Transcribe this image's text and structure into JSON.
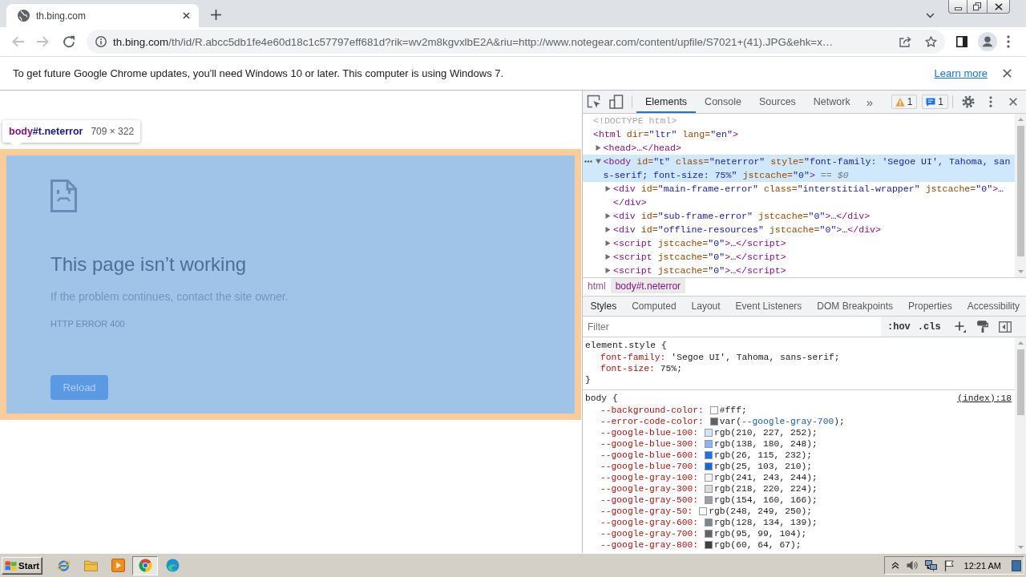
{
  "browser": {
    "tabs": [
      {
        "title": "th.bing.com",
        "selected": true
      }
    ],
    "navigation": [
      {
        "kind": "back",
        "disabled": true
      },
      {
        "kind": "forward",
        "disabled": true
      },
      {
        "kind": "reload",
        "disabled": false
      }
    ],
    "address": {
      "host": "th.bing.com",
      "path": "/th/id/R.abcc5db1fe4e60d18c1c57797eff681d?rik=wv2m8kgvxlbE2A&riu=http://www.notegear.com/content/upfile/S7021+(41).JPG&ehk=x…"
    }
  },
  "infobar": {
    "message": "To get future Google Chrome updates, you'll need Windows 10 or later. This computer is using Windows 7.",
    "link": "Learn more"
  },
  "page": {
    "inspect_tooltip": {
      "tag": "body",
      "selector": "#t.neterror",
      "size": "709 × 322"
    },
    "error": {
      "title": "This page isn’t working",
      "message": "If the problem continues, contact the site owner.",
      "code": "HTTP ERROR 400",
      "button": "Reload"
    }
  },
  "devtools": {
    "tabs": [
      {
        "label": "Elements",
        "selected": true
      },
      {
        "label": "Console",
        "selected": false
      },
      {
        "label": "Sources",
        "selected": false
      },
      {
        "label": "Network",
        "selected": false
      }
    ],
    "more_tabs": "»",
    "counters": [
      {
        "kind": "warning",
        "count": "1"
      },
      {
        "kind": "message",
        "count": "1"
      }
    ],
    "dom": [
      {
        "tokens": [
          {
            "kind": "doctype",
            "text": "<!DOCTYPE html>"
          }
        ],
        "selected": false
      },
      {
        "tokens": [
          {
            "kind": "tag",
            "text": "<html"
          },
          {
            "kind": "attr",
            "text": " dir="
          },
          {
            "kind": "value",
            "text": "\"ltr\""
          },
          {
            "kind": "attr",
            "text": " lang="
          },
          {
            "kind": "value",
            "text": "\"en\""
          },
          {
            "kind": "tag",
            "text": ">"
          }
        ],
        "selected": false,
        "children": [
          {
            "tokens": [
              {
                "kind": "tag",
                "text": "<head>"
              },
              {
                "kind": "plain",
                "text": "…"
              },
              {
                "kind": "tag",
                "text": "</head>"
              }
            ],
            "expanded": false,
            "selected": false
          },
          {
            "tokens": [
              {
                "kind": "tag",
                "text": "<body"
              },
              {
                "kind": "attr",
                "text": " id="
              },
              {
                "kind": "value",
                "text": "\"t\""
              },
              {
                "kind": "attr",
                "text": " class="
              },
              {
                "kind": "value",
                "text": "\"neterror\""
              },
              {
                "kind": "attr",
                "text": " style="
              },
              {
                "kind": "value",
                "text": "\"font-family: 'Segoe UI', Tahoma, sans-serif; font-size: 75%\""
              },
              {
                "kind": "attr",
                "text": " jstcache="
              },
              {
                "kind": "value",
                "text": "\"0\""
              },
              {
                "kind": "tag",
                "text": ">"
              },
              {
                "kind": "hint",
                "text": " == $0"
              }
            ],
            "expanded": true,
            "selected": true,
            "children": [
              {
                "tokens": [
                  {
                    "kind": "tag",
                    "text": "<div"
                  },
                  {
                    "kind": "attr",
                    "text": " id="
                  },
                  {
                    "kind": "value",
                    "text": "\"main-frame-error\""
                  },
                  {
                    "kind": "attr",
                    "text": " class="
                  },
                  {
                    "kind": "value",
                    "text": "\"interstitial-wrapper\""
                  },
                  {
                    "kind": "attr",
                    "text": " jstcache="
                  },
                  {
                    "kind": "value",
                    "text": "\"0\""
                  },
                  {
                    "kind": "tag",
                    "text": ">"
                  },
                  {
                    "kind": "plain",
                    "text": "…"
                  },
                  {
                    "kind": "tag",
                    "text": "</div>"
                  }
                ],
                "expanded": false,
                "selected": false
              },
              {
                "tokens": [
                  {
                    "kind": "tag",
                    "text": "<div"
                  },
                  {
                    "kind": "attr",
                    "text": " id="
                  },
                  {
                    "kind": "value",
                    "text": "\"sub-frame-error\""
                  },
                  {
                    "kind": "attr",
                    "text": " jstcache="
                  },
                  {
                    "kind": "value",
                    "text": "\"0\""
                  },
                  {
                    "kind": "tag",
                    "text": ">"
                  },
                  {
                    "kind": "plain",
                    "text": "…"
                  },
                  {
                    "kind": "tag",
                    "text": "</div>"
                  }
                ],
                "expanded": false,
                "selected": false
              },
              {
                "tokens": [
                  {
                    "kind": "tag",
                    "text": "<div"
                  },
                  {
                    "kind": "attr",
                    "text": " id="
                  },
                  {
                    "kind": "value",
                    "text": "\"offline-resources\""
                  },
                  {
                    "kind": "attr",
                    "text": " jstcache="
                  },
                  {
                    "kind": "value",
                    "text": "\"0\""
                  },
                  {
                    "kind": "tag",
                    "text": ">"
                  },
                  {
                    "kind": "plain",
                    "text": "…"
                  },
                  {
                    "kind": "tag",
                    "text": "</div>"
                  }
                ],
                "expanded": false,
                "selected": false
              },
              {
                "tokens": [
                  {
                    "kind": "tag",
                    "text": "<script"
                  },
                  {
                    "kind": "attr",
                    "text": " jstcache="
                  },
                  {
                    "kind": "value",
                    "text": "\"0\""
                  },
                  {
                    "kind": "tag",
                    "text": ">"
                  },
                  {
                    "kind": "plain",
                    "text": "…"
                  },
                  {
                    "kind": "tag",
                    "text": "</script>"
                  }
                ],
                "expanded": false,
                "selected": false
              },
              {
                "tokens": [
                  {
                    "kind": "tag",
                    "text": "<script"
                  },
                  {
                    "kind": "attr",
                    "text": " jstcache="
                  },
                  {
                    "kind": "value",
                    "text": "\"0\""
                  },
                  {
                    "kind": "tag",
                    "text": ">"
                  },
                  {
                    "kind": "plain",
                    "text": "…"
                  },
                  {
                    "kind": "tag",
                    "text": "</script>"
                  }
                ],
                "expanded": false,
                "selected": false
              },
              {
                "tokens": [
                  {
                    "kind": "tag",
                    "text": "<script"
                  },
                  {
                    "kind": "attr",
                    "text": " jstcache="
                  },
                  {
                    "kind": "value",
                    "text": "\"0\""
                  },
                  {
                    "kind": "tag",
                    "text": ">"
                  },
                  {
                    "kind": "plain",
                    "text": "…"
                  },
                  {
                    "kind": "tag",
                    "text": "</script>"
                  }
                ],
                "expanded": false,
                "selected": false
              }
            ]
          }
        ]
      }
    ],
    "breadcrumbs": [
      {
        "label": "html",
        "selected": false
      },
      {
        "label": "body#t.neterror",
        "selected": true
      }
    ],
    "sidebar_tabs": [
      {
        "label": "Styles",
        "selected": true
      },
      {
        "label": "Computed",
        "selected": false
      },
      {
        "label": "Layout",
        "selected": false
      },
      {
        "label": "Event Listeners",
        "selected": false
      },
      {
        "label": "DOM Breakpoints",
        "selected": false
      },
      {
        "label": "Properties",
        "selected": false
      },
      {
        "label": "Accessibility",
        "selected": false
      }
    ],
    "filter": {
      "placeholder": "Filter"
    },
    "filter_toggles": [
      ":hov",
      ".cls"
    ],
    "rules": [
      {
        "selector": "element.style {",
        "declarations": [
          {
            "name": "font-family:",
            "value": "'Segoe UI', Tahoma, sans-serif;"
          },
          {
            "name": "font-size:",
            "value": "75%;"
          }
        ],
        "close": "}"
      },
      {
        "selector": "body {",
        "source": "(index):18",
        "declarations": [
          {
            "name": "--background-color:",
            "color": "#ffffff",
            "value": "#fff;"
          },
          {
            "name": "--error-code-color:",
            "color": "#5f6368",
            "value": "var(",
            "var_ref": "--google-gray-700",
            "value_end": ");"
          },
          {
            "name": "--google-blue-100:",
            "color": "#d2e3fc",
            "value": "rgb(210, 227, 252);"
          },
          {
            "name": "--google-blue-300:",
            "color": "#8ab4f8",
            "value": "rgb(138, 180, 248);"
          },
          {
            "name": "--google-blue-600:",
            "color": "#1a73e8",
            "value": "rgb(26, 115, 232);"
          },
          {
            "name": "--google-blue-700:",
            "color": "#1967d2",
            "value": "rgb(25, 103, 210);"
          },
          {
            "name": "--google-gray-100:",
            "color": "#f1f3f4",
            "value": "rgb(241, 243, 244);"
          },
          {
            "name": "--google-gray-300:",
            "color": "#dadce0",
            "value": "rgb(218, 220, 224);"
          },
          {
            "name": "--google-gray-500:",
            "color": "#9aa0a6",
            "value": "rgb(154, 160, 166);"
          },
          {
            "name": "--google-gray-50:",
            "color": "#f8f9fa",
            "value": "rgb(248, 249, 250);"
          },
          {
            "name": "--google-gray-600:",
            "color": "#80868b",
            "value": "rgb(128, 134, 139);"
          },
          {
            "name": "--google-gray-700:",
            "color": "#5f6368",
            "value": "rgb(95, 99, 104);"
          },
          {
            "name": "--google-gray-800:",
            "color": "#3c4043",
            "value": "rgb(60, 64, 67);"
          }
        ]
      }
    ]
  },
  "taskbar": {
    "start": "Start",
    "apps": [
      {
        "kind": "globe",
        "active": false
      },
      {
        "kind": "folder",
        "active": false
      },
      {
        "kind": "player",
        "active": false
      },
      {
        "kind": "ring",
        "active": true
      },
      {
        "kind": "swirl",
        "active": false
      }
    ],
    "clock": "12:21 AM"
  }
}
